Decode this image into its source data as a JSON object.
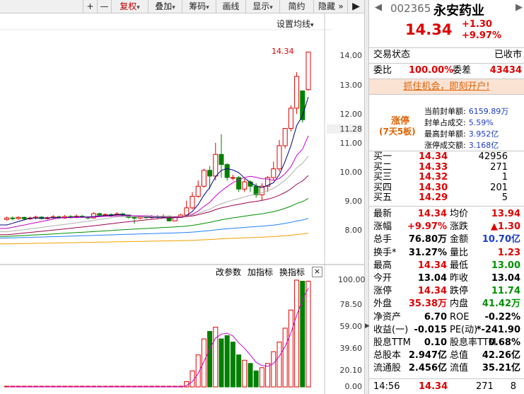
{
  "toolbar": {
    "plus": "+",
    "minus": "—",
    "fuquan": "复权",
    "diejia": "叠加",
    "chouma": "筹码",
    "huaxian": "画线",
    "xianshi": "显示",
    "jianyue": "简约",
    "yincang": "隐藏",
    "more": "»",
    "prev_arrow": "◀",
    "next_arrow": "▶"
  },
  "chart": {
    "set_ma": "设置均线",
    "price_tag": "14.34",
    "price_axis": [
      "14.00",
      "13.00",
      "12.00",
      "11.28",
      "11.00",
      "10.00",
      "9.00",
      "8.00"
    ],
    "indicator_axis": [
      "100.00",
      "78.50",
      "59.00",
      "39.60",
      "20.10",
      "0.00"
    ],
    "btn_params": "改参数",
    "btn_add": "加指标",
    "btn_switch": "换指标",
    "btn_close": "×",
    "colors": {
      "up": "#e00000",
      "down": "#008000",
      "ma1": "#000080",
      "ma2": "#cc00cc",
      "ma3": "#b0b0b0",
      "ma4": "#a00050",
      "ma5": "#009000",
      "ma6": "#2080ff",
      "ma7": "#f0a000"
    }
  },
  "chart_data": {
    "type": "candlestick",
    "ylim": [
      7.6,
      14.7
    ],
    "last_price": 14.34,
    "candles": [
      {
        "o": 8.55,
        "c": 8.6,
        "h": 8.65,
        "l": 8.5
      },
      {
        "o": 8.6,
        "c": 8.58,
        "h": 8.65,
        "l": 8.52
      },
      {
        "o": 8.58,
        "c": 8.62,
        "h": 8.66,
        "l": 8.54
      },
      {
        "o": 8.62,
        "c": 8.57,
        "h": 8.65,
        "l": 8.52
      },
      {
        "o": 8.57,
        "c": 8.6,
        "h": 8.64,
        "l": 8.53
      },
      {
        "o": 8.6,
        "c": 8.63,
        "h": 8.68,
        "l": 8.55
      },
      {
        "o": 8.63,
        "c": 8.58,
        "h": 8.66,
        "l": 8.54
      },
      {
        "o": 8.58,
        "c": 8.61,
        "h": 8.65,
        "l": 8.55
      },
      {
        "o": 8.61,
        "c": 8.64,
        "h": 8.7,
        "l": 8.57
      },
      {
        "o": 8.64,
        "c": 8.6,
        "h": 8.68,
        "l": 8.56
      },
      {
        "o": 8.6,
        "c": 8.65,
        "h": 8.7,
        "l": 8.57
      },
      {
        "o": 8.65,
        "c": 8.62,
        "h": 8.7,
        "l": 8.58
      },
      {
        "o": 8.62,
        "c": 8.66,
        "h": 8.72,
        "l": 8.59
      },
      {
        "o": 8.66,
        "c": 8.63,
        "h": 8.7,
        "l": 8.6
      },
      {
        "o": 8.63,
        "c": 8.6,
        "h": 8.66,
        "l": 8.55
      },
      {
        "o": 8.6,
        "c": 8.75,
        "h": 8.8,
        "l": 8.58
      },
      {
        "o": 8.75,
        "c": 8.7,
        "h": 8.78,
        "l": 8.66
      },
      {
        "o": 8.7,
        "c": 8.72,
        "h": 8.76,
        "l": 8.66
      },
      {
        "o": 8.72,
        "c": 8.68,
        "h": 8.76,
        "l": 8.64
      },
      {
        "o": 8.68,
        "c": 8.74,
        "h": 8.8,
        "l": 8.65
      },
      {
        "o": 8.74,
        "c": 8.7,
        "h": 8.78,
        "l": 8.66
      },
      {
        "o": 8.7,
        "c": 8.62,
        "h": 8.72,
        "l": 8.58
      },
      {
        "o": 8.62,
        "c": 8.6,
        "h": 8.66,
        "l": 8.4
      },
      {
        "o": 8.6,
        "c": 8.64,
        "h": 8.68,
        "l": 8.55
      },
      {
        "o": 8.64,
        "c": 8.61,
        "h": 8.68,
        "l": 8.57
      },
      {
        "o": 8.61,
        "c": 8.65,
        "h": 8.7,
        "l": 8.58
      },
      {
        "o": 8.65,
        "c": 8.62,
        "h": 8.7,
        "l": 8.58
      },
      {
        "o": 8.62,
        "c": 8.66,
        "h": 8.72,
        "l": 8.6
      },
      {
        "o": 8.66,
        "c": 8.5,
        "h": 8.68,
        "l": 8.48
      },
      {
        "o": 8.5,
        "c": 8.62,
        "h": 8.66,
        "l": 8.48
      },
      {
        "o": 8.62,
        "c": 8.7,
        "h": 8.75,
        "l": 8.6
      },
      {
        "o": 8.7,
        "c": 8.95,
        "h": 9.2,
        "l": 8.68
      },
      {
        "o": 8.95,
        "c": 9.35,
        "h": 9.5,
        "l": 8.9
      },
      {
        "o": 9.35,
        "c": 9.7,
        "h": 9.9,
        "l": 9.3
      },
      {
        "o": 9.7,
        "c": 10.25,
        "h": 10.3,
        "l": 9.65
      },
      {
        "o": 10.25,
        "c": 10.05,
        "h": 10.4,
        "l": 9.6
      },
      {
        "o": 10.05,
        "c": 10.8,
        "h": 11.2,
        "l": 9.9
      },
      {
        "o": 10.8,
        "c": 10.45,
        "h": 11.5,
        "l": 10.0
      },
      {
        "o": 10.45,
        "c": 10.0,
        "h": 10.5,
        "l": 9.9
      },
      {
        "o": 10.0,
        "c": 10.0,
        "h": 10.1,
        "l": 9.9
      },
      {
        "o": 10.0,
        "c": 9.6,
        "h": 10.05,
        "l": 9.5
      },
      {
        "o": 9.6,
        "c": 9.85,
        "h": 9.95,
        "l": 9.5
      },
      {
        "o": 9.85,
        "c": 9.7,
        "h": 9.9,
        "l": 9.5
      },
      {
        "o": 9.7,
        "c": 9.4,
        "h": 9.8,
        "l": 9.3
      },
      {
        "o": 9.4,
        "c": 9.7,
        "h": 9.8,
        "l": 9.2
      },
      {
        "o": 9.7,
        "c": 10.0,
        "h": 10.05,
        "l": 9.5
      },
      {
        "o": 10.0,
        "c": 10.3,
        "h": 10.55,
        "l": 9.9
      },
      {
        "o": 10.3,
        "c": 11.1,
        "h": 11.3,
        "l": 10.2
      },
      {
        "o": 11.1,
        "c": 11.7,
        "h": 11.7,
        "l": 11.0
      },
      {
        "o": 11.7,
        "c": 12.4,
        "h": 12.5,
        "l": 11.6
      },
      {
        "o": 12.4,
        "c": 13.5,
        "h": 13.65,
        "l": 12.2
      },
      {
        "o": 13.0,
        "c": 12.0,
        "h": 13.0,
        "l": 11.9
      },
      {
        "o": 13.04,
        "c": 14.34,
        "h": 14.34,
        "l": 13.0
      }
    ],
    "ma_series": [
      "MA-blue",
      "MA-magenta",
      "MA-gray",
      "MA-maroon",
      "MA-green",
      "MA-lightblue",
      "MA-orange"
    ],
    "indicator": {
      "type": "bar",
      "ylim": [
        0,
        100
      ],
      "values": [
        0,
        0,
        0,
        0,
        0,
        0,
        0,
        0,
        0,
        0,
        0,
        0,
        0,
        0,
        0,
        0,
        0,
        0,
        0,
        0,
        0,
        0,
        0,
        0,
        0,
        0,
        0,
        0,
        0,
        0,
        0,
        5,
        15,
        30,
        45,
        52,
        56,
        45,
        48,
        42,
        30,
        25,
        22,
        15,
        18,
        22,
        33,
        42,
        55,
        72,
        100,
        99,
        99
      ],
      "up_flags": [
        1,
        1,
        1,
        1,
        1,
        1,
        1,
        1,
        1,
        1,
        1,
        1,
        1,
        1,
        1,
        1,
        1,
        1,
        1,
        1,
        1,
        1,
        1,
        1,
        1,
        1,
        1,
        1,
        1,
        1,
        1,
        1,
        1,
        1,
        1,
        0,
        1,
        0,
        0,
        0,
        0,
        1,
        0,
        0,
        1,
        1,
        1,
        1,
        1,
        1,
        1,
        0,
        1
      ]
    }
  },
  "quote": {
    "code": "002365",
    "name": "永安药业",
    "price": "14.34",
    "change": "+1.30",
    "change_pct": "+9.97%"
  },
  "status": {
    "label": "交易状态",
    "value": "已收市"
  },
  "weibi": {
    "label": "委比",
    "value": "100.00%",
    "label2": "委差",
    "value2": "43434"
  },
  "promo": "抓住机会，即刻开户!",
  "limit_up": {
    "tag": "涨停",
    "streak": "(7天5板)",
    "rows": [
      {
        "label": "当前封单额:",
        "value": "6159.89万"
      },
      {
        "label": "封单占成交:",
        "value": "5.59%"
      },
      {
        "label": "最高封单额:",
        "value": "3.952亿"
      },
      {
        "label": "涨停成交额:",
        "value": "3.168亿"
      }
    ]
  },
  "bids": [
    {
      "label": "买一",
      "price": "14.34",
      "vol": "42956"
    },
    {
      "label": "买二",
      "price": "14.33",
      "vol": "271"
    },
    {
      "label": "买三",
      "price": "14.32",
      "vol": "1"
    },
    {
      "label": "买四",
      "price": "14.30",
      "vol": "201"
    },
    {
      "label": "买五",
      "price": "14.29",
      "vol": "5"
    }
  ],
  "stats": [
    {
      "l1": "最新",
      "v1": "14.34",
      "c1": "red",
      "l2": "均价",
      "v2": "13.94",
      "c2": "red"
    },
    {
      "l1": "涨幅",
      "v1": "+9.97%",
      "c1": "red",
      "l2": "涨跌",
      "v2": "▲1.30",
      "c2": "red"
    },
    {
      "l1": "总手",
      "v1": "76.80万",
      "c1": "black",
      "l2": "金额",
      "v2": "10.70亿",
      "c2": "blue"
    },
    {
      "l1": "换手*",
      "v1": "31.27%",
      "c1": "black",
      "l2": "量比",
      "v2": "1.23",
      "c2": "red"
    },
    {
      "l1": "最高",
      "v1": "14.34",
      "c1": "red",
      "l2": "最低",
      "v2": "13.00",
      "c2": "green"
    },
    {
      "l1": "今开",
      "v1": "13.04",
      "c1": "black",
      "l2": "昨收",
      "v2": "13.04",
      "c2": "black"
    },
    {
      "l1": "涨停",
      "v1": "14.34",
      "c1": "red",
      "l2": "跌停",
      "v2": "11.74",
      "c2": "green"
    },
    {
      "l1": "外盘",
      "v1": "35.38万",
      "c1": "red",
      "l2": "内盘",
      "v2": "41.42万",
      "c2": "green"
    },
    {
      "l1": "净资产",
      "v1": "6.70",
      "c1": "black",
      "l2": "ROE",
      "v2": "-0.22%",
      "c2": "black"
    },
    {
      "l1": "收益(一)",
      "v1": "-0.015",
      "c1": "black",
      "l2": "PE(动)",
      "v2": "*-241.90",
      "c2": "black"
    },
    {
      "l1": "股息TTM",
      "v1": "0.10",
      "c1": "black",
      "l2": "股息率TTM",
      "v2": "0.68%",
      "c2": "black"
    },
    {
      "l1": "总股本",
      "v1": "2.947亿",
      "c1": "black",
      "l2": "总值",
      "v2": "42.26亿",
      "c2": "black"
    },
    {
      "l1": "流通股",
      "v1": "2.456亿",
      "c1": "black",
      "l2": "流值",
      "v2": "35.21亿",
      "c2": "black"
    }
  ],
  "tick": {
    "time": "14:56",
    "price": "14.34",
    "vol": "271",
    "count": "8"
  }
}
